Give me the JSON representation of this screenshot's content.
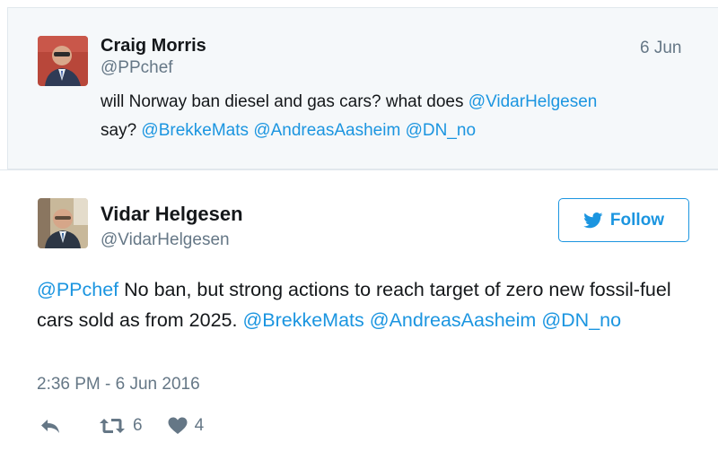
{
  "parent_tweet": {
    "author_name": "Craig Morris",
    "author_handle": "@PPchef",
    "date": "6 Jun",
    "text_line1_prefix": "will Norway ban diesel and gas cars? what does ",
    "mention_vidar": "@VidarHelgesen",
    "text_line2_prefix": "say? ",
    "mention_brekke": "@BrekkeMats",
    "mention_aasheim": "@AndreasAasheim",
    "mention_dn": "@DN_no"
  },
  "main_tweet": {
    "author_name": "Vidar Helgesen",
    "author_handle": "@VidarHelgesen",
    "follow_label": "Follow",
    "mention_ppchef": "@PPchef",
    "body_part1": " No ban, but strong actions to reach target of zero new fossil-fuel cars sold as from 2025. ",
    "mention_brekke": "@BrekkeMats",
    "mention_aasheim": "@AndreasAasheim",
    "mention_dn": "@DN_no",
    "timestamp": "2:36 PM - 6 Jun 2016",
    "retweet_count": "6",
    "like_count": "4"
  },
  "icons": {
    "reply": "reply-icon",
    "retweet": "retweet-icon",
    "like": "heart-icon",
    "bird": "twitter-bird-icon"
  },
  "colors": {
    "link": "#1b95e0",
    "muted": "#657786",
    "parent_bg": "#f5f8fa"
  }
}
